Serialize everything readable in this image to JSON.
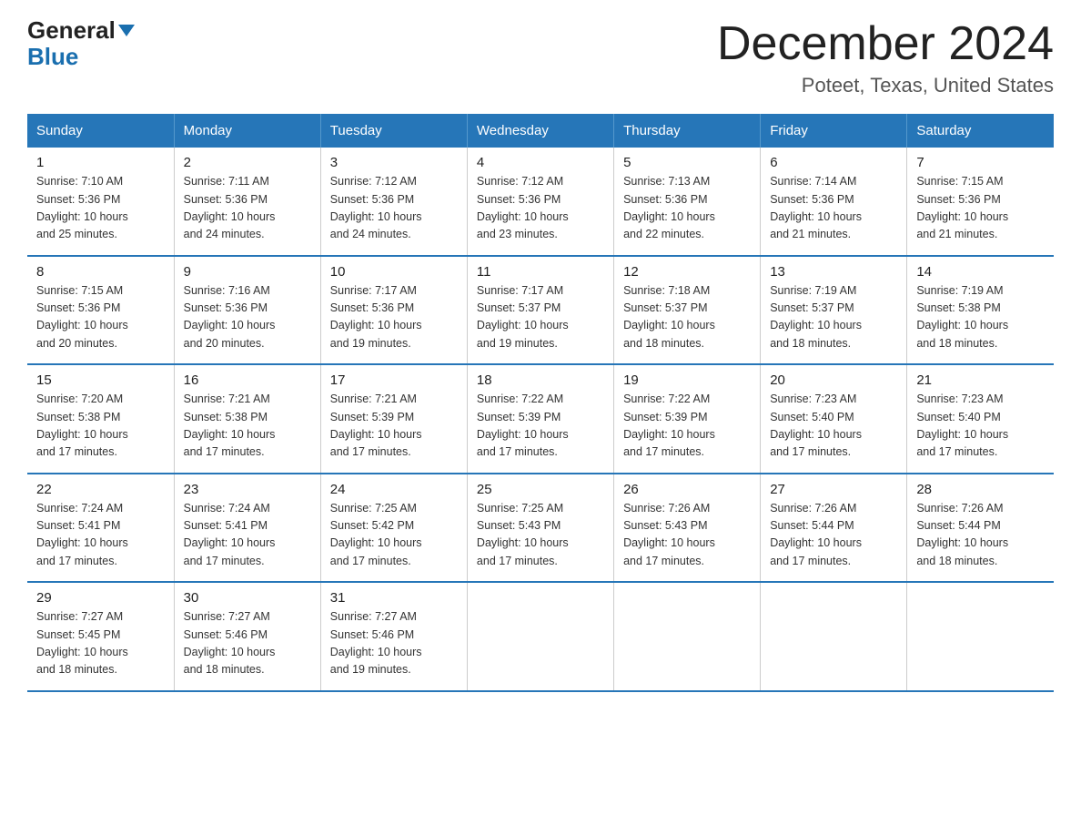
{
  "logo": {
    "general": "General",
    "blue": "Blue",
    "arrow": "▼"
  },
  "header": {
    "month": "December 2024",
    "location": "Poteet, Texas, United States"
  },
  "days_of_week": [
    "Sunday",
    "Monday",
    "Tuesday",
    "Wednesday",
    "Thursday",
    "Friday",
    "Saturday"
  ],
  "weeks": [
    [
      {
        "day": "1",
        "sunrise": "7:10 AM",
        "sunset": "5:36 PM",
        "daylight": "10 hours and 25 minutes."
      },
      {
        "day": "2",
        "sunrise": "7:11 AM",
        "sunset": "5:36 PM",
        "daylight": "10 hours and 24 minutes."
      },
      {
        "day": "3",
        "sunrise": "7:12 AM",
        "sunset": "5:36 PM",
        "daylight": "10 hours and 24 minutes."
      },
      {
        "day": "4",
        "sunrise": "7:12 AM",
        "sunset": "5:36 PM",
        "daylight": "10 hours and 23 minutes."
      },
      {
        "day": "5",
        "sunrise": "7:13 AM",
        "sunset": "5:36 PM",
        "daylight": "10 hours and 22 minutes."
      },
      {
        "day": "6",
        "sunrise": "7:14 AM",
        "sunset": "5:36 PM",
        "daylight": "10 hours and 21 minutes."
      },
      {
        "day": "7",
        "sunrise": "7:15 AM",
        "sunset": "5:36 PM",
        "daylight": "10 hours and 21 minutes."
      }
    ],
    [
      {
        "day": "8",
        "sunrise": "7:15 AM",
        "sunset": "5:36 PM",
        "daylight": "10 hours and 20 minutes."
      },
      {
        "day": "9",
        "sunrise": "7:16 AM",
        "sunset": "5:36 PM",
        "daylight": "10 hours and 20 minutes."
      },
      {
        "day": "10",
        "sunrise": "7:17 AM",
        "sunset": "5:36 PM",
        "daylight": "10 hours and 19 minutes."
      },
      {
        "day": "11",
        "sunrise": "7:17 AM",
        "sunset": "5:37 PM",
        "daylight": "10 hours and 19 minutes."
      },
      {
        "day": "12",
        "sunrise": "7:18 AM",
        "sunset": "5:37 PM",
        "daylight": "10 hours and 18 minutes."
      },
      {
        "day": "13",
        "sunrise": "7:19 AM",
        "sunset": "5:37 PM",
        "daylight": "10 hours and 18 minutes."
      },
      {
        "day": "14",
        "sunrise": "7:19 AM",
        "sunset": "5:38 PM",
        "daylight": "10 hours and 18 minutes."
      }
    ],
    [
      {
        "day": "15",
        "sunrise": "7:20 AM",
        "sunset": "5:38 PM",
        "daylight": "10 hours and 17 minutes."
      },
      {
        "day": "16",
        "sunrise": "7:21 AM",
        "sunset": "5:38 PM",
        "daylight": "10 hours and 17 minutes."
      },
      {
        "day": "17",
        "sunrise": "7:21 AM",
        "sunset": "5:39 PM",
        "daylight": "10 hours and 17 minutes."
      },
      {
        "day": "18",
        "sunrise": "7:22 AM",
        "sunset": "5:39 PM",
        "daylight": "10 hours and 17 minutes."
      },
      {
        "day": "19",
        "sunrise": "7:22 AM",
        "sunset": "5:39 PM",
        "daylight": "10 hours and 17 minutes."
      },
      {
        "day": "20",
        "sunrise": "7:23 AM",
        "sunset": "5:40 PM",
        "daylight": "10 hours and 17 minutes."
      },
      {
        "day": "21",
        "sunrise": "7:23 AM",
        "sunset": "5:40 PM",
        "daylight": "10 hours and 17 minutes."
      }
    ],
    [
      {
        "day": "22",
        "sunrise": "7:24 AM",
        "sunset": "5:41 PM",
        "daylight": "10 hours and 17 minutes."
      },
      {
        "day": "23",
        "sunrise": "7:24 AM",
        "sunset": "5:41 PM",
        "daylight": "10 hours and 17 minutes."
      },
      {
        "day": "24",
        "sunrise": "7:25 AM",
        "sunset": "5:42 PM",
        "daylight": "10 hours and 17 minutes."
      },
      {
        "day": "25",
        "sunrise": "7:25 AM",
        "sunset": "5:43 PM",
        "daylight": "10 hours and 17 minutes."
      },
      {
        "day": "26",
        "sunrise": "7:26 AM",
        "sunset": "5:43 PM",
        "daylight": "10 hours and 17 minutes."
      },
      {
        "day": "27",
        "sunrise": "7:26 AM",
        "sunset": "5:44 PM",
        "daylight": "10 hours and 17 minutes."
      },
      {
        "day": "28",
        "sunrise": "7:26 AM",
        "sunset": "5:44 PM",
        "daylight": "10 hours and 18 minutes."
      }
    ],
    [
      {
        "day": "29",
        "sunrise": "7:27 AM",
        "sunset": "5:45 PM",
        "daylight": "10 hours and 18 minutes."
      },
      {
        "day": "30",
        "sunrise": "7:27 AM",
        "sunset": "5:46 PM",
        "daylight": "10 hours and 18 minutes."
      },
      {
        "day": "31",
        "sunrise": "7:27 AM",
        "sunset": "5:46 PM",
        "daylight": "10 hours and 19 minutes."
      },
      null,
      null,
      null,
      null
    ]
  ],
  "labels": {
    "sunrise": "Sunrise:",
    "sunset": "Sunset:",
    "daylight": "Daylight:"
  }
}
